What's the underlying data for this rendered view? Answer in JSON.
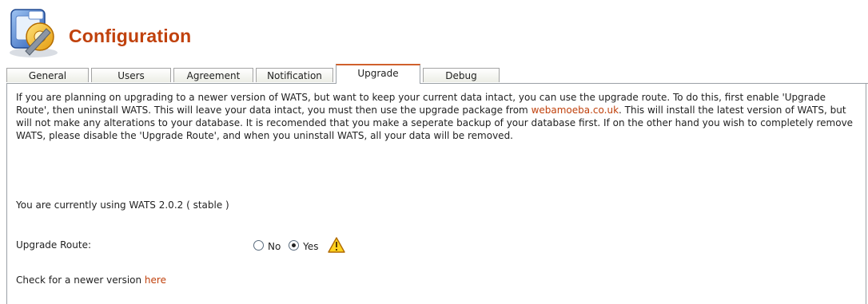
{
  "page": {
    "title": "Configuration",
    "icon": "configuration-icon"
  },
  "tabs": [
    {
      "label": "General",
      "active": false
    },
    {
      "label": "Users",
      "active": false
    },
    {
      "label": "Agreement",
      "active": false
    },
    {
      "label": "Notification",
      "active": false
    },
    {
      "label": "Upgrade",
      "active": true
    },
    {
      "label": "Debug",
      "active": false
    }
  ],
  "upgrade": {
    "description_part1": "If you are planning on upgrading to a newer version of WATS, but want to keep your current data intact, you can use the upgrade route. To do this, first enable 'Upgrade Route', then uninstall WATS. This will leave your data intact, you must then use the upgrade package from ",
    "link_text": "webamoeba.co.uk",
    "description_part2": ". This will install the latest version of WATS, but will not make any alterations to your database. It is recomended that you make a seperate backup of your database first. If on the other hand you wish to completely remove WATS, please disable the 'Upgrade Route', and when you uninstall WATS, all your data will be removed.",
    "version_text": "You are currently using WATS 2.0.2 ( stable )",
    "route_label": "Upgrade Route:",
    "option_no": "No",
    "option_yes": "Yes",
    "selected": "Yes",
    "warning_icon": "warning-icon",
    "check_text": "Check for a newer version ",
    "check_link": "here"
  },
  "colors": {
    "title": "#c0410c",
    "link": "#c0410c",
    "active_tab_accent": "#d0602c"
  }
}
